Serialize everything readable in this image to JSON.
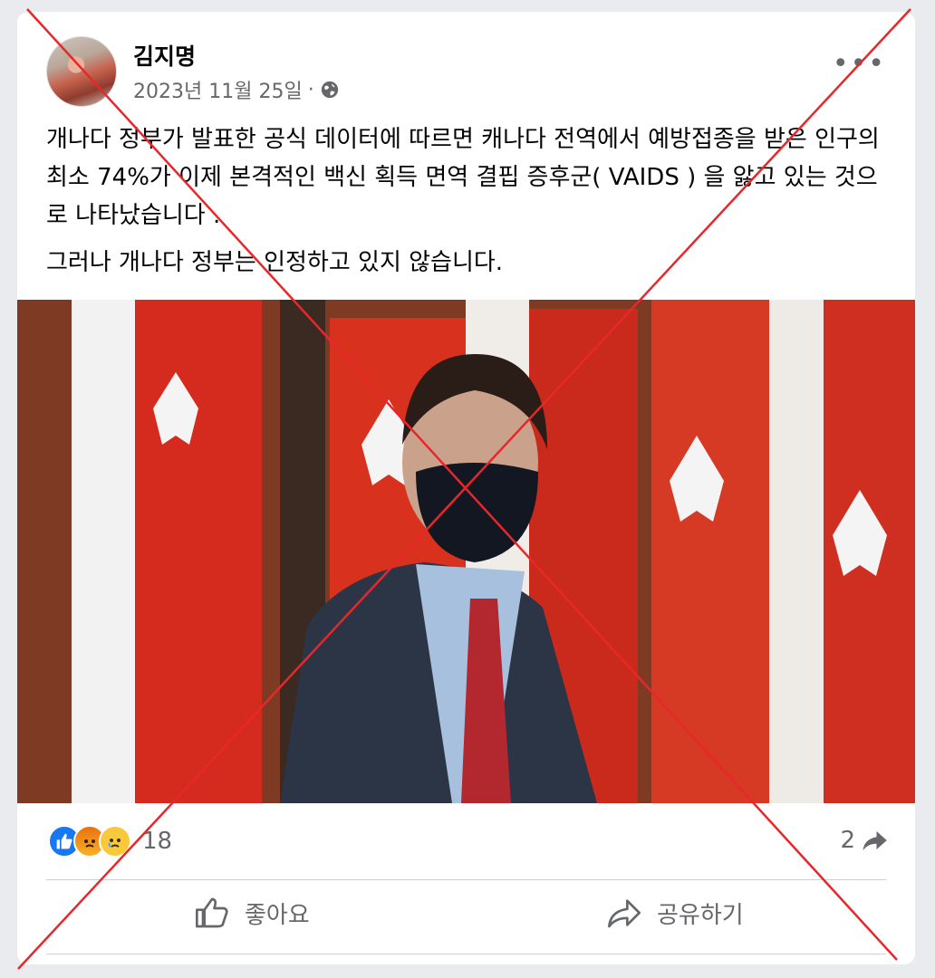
{
  "post": {
    "author": "김지명",
    "date": "2023년 11월 25일",
    "date_separator": "·",
    "more_label": "•••",
    "paragraphs": [
      "개나다 정부가 발표한 공식 데이터에 따르면 캐나다 전역에서 예방접종을 받은 인구의 최소 74%가 이제 본격적인 백신 획득 면역 결핍 증후군( VAIDS ) 을 앓고 있는 것으로 나타났습니다 .",
      "그러나 개나다 정부는 인정하고 있지 않습니다."
    ]
  },
  "reactions": {
    "icons": [
      "like-icon",
      "angry-icon",
      "sad-icon"
    ],
    "count": "18"
  },
  "shares": {
    "count": "2"
  },
  "actions": {
    "like_label": "좋아요",
    "share_label": "공유하기"
  },
  "colors": {
    "overlay_red": "#e8272b",
    "like_blue": "#1877f2",
    "text_secondary": "#65676b"
  }
}
